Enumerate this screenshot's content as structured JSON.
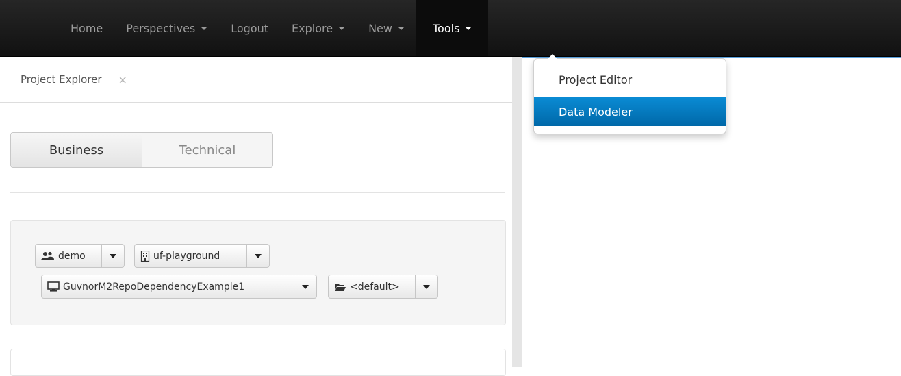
{
  "navbar": {
    "items": [
      {
        "label": "Home",
        "has_caret": false
      },
      {
        "label": "Perspectives",
        "has_caret": true
      },
      {
        "label": "Logout",
        "has_caret": false
      },
      {
        "label": "Explore",
        "has_caret": true
      },
      {
        "label": "New",
        "has_caret": true
      },
      {
        "label": "Tools",
        "has_caret": true,
        "active": true
      }
    ]
  },
  "tools_menu": {
    "items": [
      {
        "label": "Project Editor"
      },
      {
        "label": "Data Modeler",
        "selected": true
      }
    ],
    "selected_color": "#0078c0"
  },
  "panel": {
    "tab_label": "Project Explorer",
    "close_glyph": "×",
    "view_toggle": {
      "business_label": "Business",
      "technical_label": "Technical",
      "active": "Business"
    },
    "selectors": {
      "organization": {
        "label": "demo",
        "icon": "users-icon"
      },
      "repository": {
        "label": "uf-playground",
        "icon": "building-icon"
      },
      "project": {
        "label": "GuvnorM2RepoDependencyExample1",
        "icon": "monitor-icon"
      },
      "package": {
        "label": "<default>",
        "icon": "folder-open-icon"
      }
    }
  },
  "colors": {
    "navbar_bg": "#1a1a1a",
    "accent": "#0078c0",
    "splitter": "#e5e5e5"
  }
}
